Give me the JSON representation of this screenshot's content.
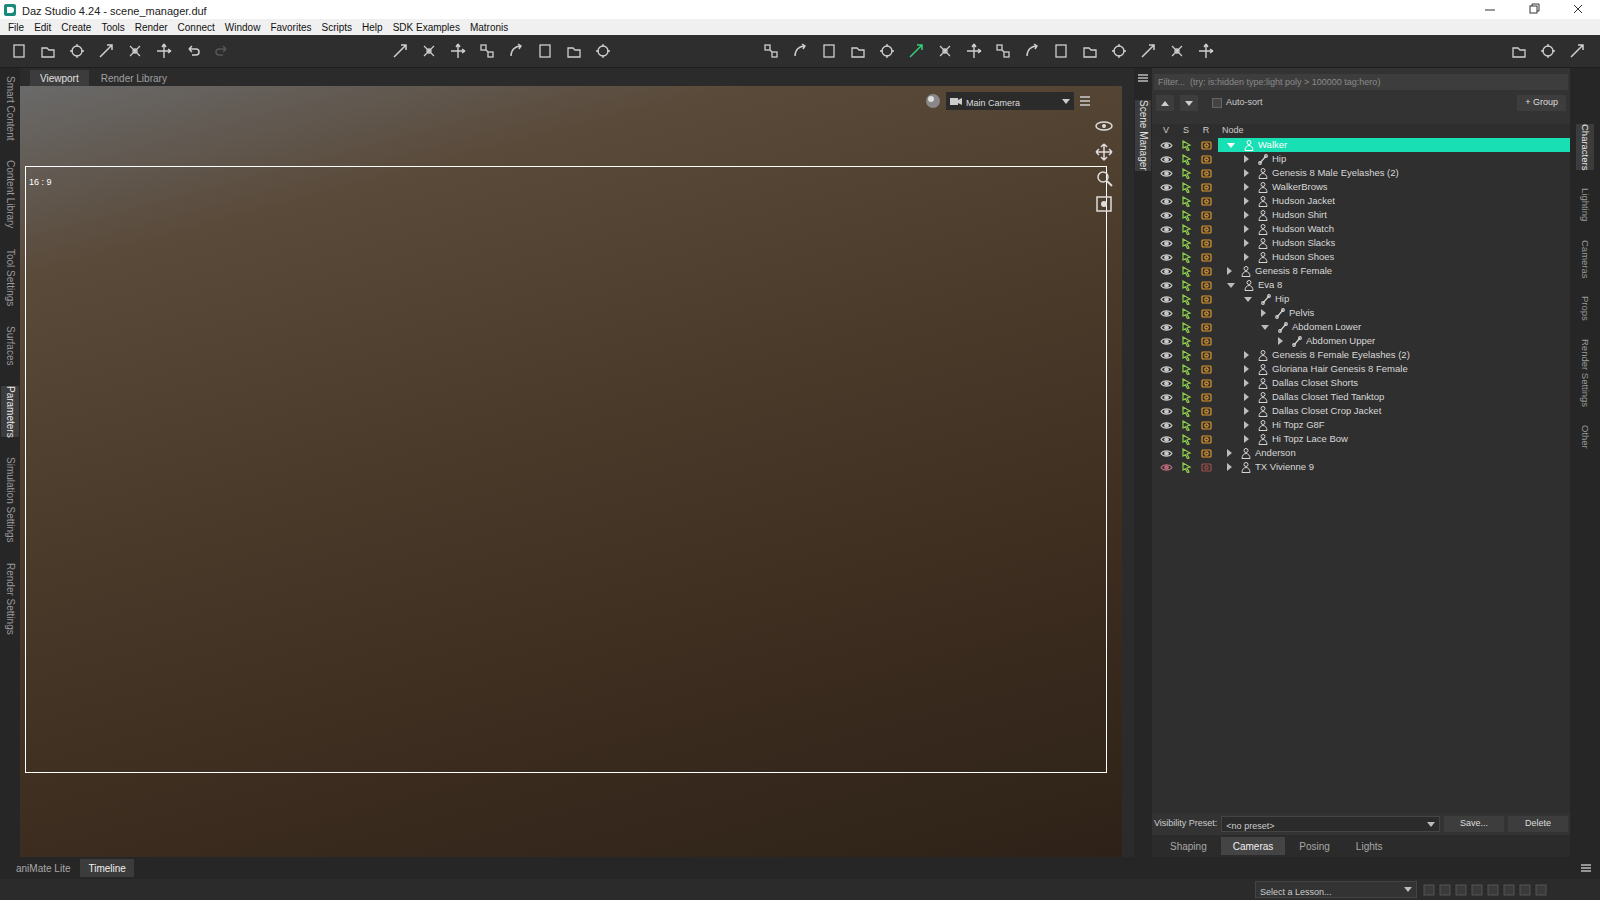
{
  "window": {
    "title": "Daz Studio 4.24 - scene_manager.duf"
  },
  "menu": [
    "File",
    "Edit",
    "Create",
    "Tools",
    "Render",
    "Connect",
    "Window",
    "Favorites",
    "Scripts",
    "Help",
    "SDK Examples",
    "Matronis"
  ],
  "left_tabs": [
    {
      "label": "Smart Content",
      "selected": false
    },
    {
      "label": "Content Library",
      "selected": false
    },
    {
      "label": "Tool Settings",
      "selected": false
    },
    {
      "label": "Surfaces",
      "selected": false
    },
    {
      "label": "Parameters",
      "selected": true
    },
    {
      "label": "Simulation Settings",
      "selected": false
    },
    {
      "label": "Render Settings",
      "selected": false
    }
  ],
  "viewport": {
    "tabs": [
      {
        "label": "Viewport",
        "selected": true
      },
      {
        "label": "Render Library",
        "selected": false
      }
    ],
    "aspect": "16 : 9",
    "camera": "Main Camera"
  },
  "scene_manager": {
    "title": "Scene Manager",
    "filter": {
      "placeholder": "Filter...  (try: is:hidden type:light poly > 100000 tag:hero)"
    },
    "auto_sort": {
      "label": "Auto-sort",
      "checked": false
    },
    "group_button": "+ Group",
    "columns": [
      "V",
      "S",
      "R",
      "Node"
    ],
    "nodes": [
      {
        "name": "Walker",
        "depth": 0,
        "kind": "figure",
        "expanded": true,
        "selected": true,
        "visible": true
      },
      {
        "name": "Hip",
        "depth": 1,
        "kind": "bone",
        "expanded": false,
        "selected": false,
        "visible": true
      },
      {
        "name": "Genesis 8 Male Eyelashes (2)",
        "depth": 1,
        "kind": "figure",
        "expanded": false,
        "selected": false,
        "visible": true
      },
      {
        "name": "WalkerBrows",
        "depth": 1,
        "kind": "figure",
        "expanded": false,
        "selected": false,
        "visible": true
      },
      {
        "name": "Hudson Jacket",
        "depth": 1,
        "kind": "figure",
        "expanded": false,
        "selected": false,
        "visible": true
      },
      {
        "name": "Hudson Shirt",
        "depth": 1,
        "kind": "figure",
        "expanded": false,
        "selected": false,
        "visible": true
      },
      {
        "name": "Hudson Watch",
        "depth": 1,
        "kind": "figure",
        "expanded": false,
        "selected": false,
        "visible": true
      },
      {
        "name": "Hudson Slacks",
        "depth": 1,
        "kind": "figure",
        "expanded": false,
        "selected": false,
        "visible": true
      },
      {
        "name": "Hudson Shoes",
        "depth": 1,
        "kind": "figure",
        "expanded": false,
        "selected": false,
        "visible": true
      },
      {
        "name": "Genesis 8 Female",
        "depth": 0,
        "kind": "figure",
        "expanded": false,
        "selected": false,
        "visible": true
      },
      {
        "name": "Eva 8",
        "depth": 0,
        "kind": "figure",
        "expanded": true,
        "selected": false,
        "visible": true
      },
      {
        "name": "Hip",
        "depth": 1,
        "kind": "bone",
        "expanded": true,
        "selected": false,
        "visible": true
      },
      {
        "name": "Pelvis",
        "depth": 2,
        "kind": "bone",
        "expanded": false,
        "selected": false,
        "visible": true
      },
      {
        "name": "Abdomen Lower",
        "depth": 2,
        "kind": "bone",
        "expanded": true,
        "selected": false,
        "visible": true
      },
      {
        "name": "Abdomen Upper",
        "depth": 3,
        "kind": "bone",
        "expanded": false,
        "selected": false,
        "visible": true
      },
      {
        "name": "Genesis 8 Female Eyelashes (2)",
        "depth": 1,
        "kind": "figure",
        "expanded": false,
        "selected": false,
        "visible": true
      },
      {
        "name": "Gloriana Hair Genesis 8 Female",
        "depth": 1,
        "kind": "figure",
        "expanded": false,
        "selected": false,
        "visible": true
      },
      {
        "name": "Dallas Closet Shorts",
        "depth": 1,
        "kind": "figure",
        "expanded": false,
        "selected": false,
        "visible": true
      },
      {
        "name": "Dallas Closet Tied Tanktop",
        "depth": 1,
        "kind": "figure",
        "expanded": false,
        "selected": false,
        "visible": true
      },
      {
        "name": "Dallas Closet Crop Jacket",
        "depth": 1,
        "kind": "figure",
        "expanded": false,
        "selected": false,
        "visible": true
      },
      {
        "name": "Hi Topz G8F",
        "depth": 1,
        "kind": "figure",
        "expanded": false,
        "selected": false,
        "visible": true
      },
      {
        "name": "Hi Topz Lace Bow",
        "depth": 1,
        "kind": "figure",
        "expanded": false,
        "selected": false,
        "visible": true
      },
      {
        "name": "Anderson",
        "depth": 0,
        "kind": "figure",
        "expanded": false,
        "selected": false,
        "visible": true
      },
      {
        "name": "TX Vivienne 9",
        "depth": 0,
        "kind": "figure",
        "expanded": false,
        "selected": false,
        "visible": false
      }
    ],
    "visibility_preset": {
      "label": "Visibility Preset:",
      "value": "<no preset>"
    },
    "buttons": [
      "Save...",
      "Delete"
    ]
  },
  "right_tabs": [
    {
      "label": "Characters",
      "selected": true
    },
    {
      "label": "Lighting",
      "selected": false
    },
    {
      "label": "Cameras",
      "selected": false
    },
    {
      "label": "Props",
      "selected": false
    },
    {
      "label": "Render Settings",
      "selected": false
    },
    {
      "label": "Other",
      "selected": false
    }
  ],
  "bottom_tabs": [
    {
      "label": "Shaping",
      "selected": false
    },
    {
      "label": "Cameras",
      "selected": true
    },
    {
      "label": "Posing",
      "selected": false
    },
    {
      "label": "Lights",
      "selected": false
    }
  ],
  "timeline_tabs": [
    {
      "label": "aniMate Lite",
      "selected": false
    },
    {
      "label": "Timeline",
      "selected": true
    }
  ],
  "lesson": "Select a Lesson..."
}
